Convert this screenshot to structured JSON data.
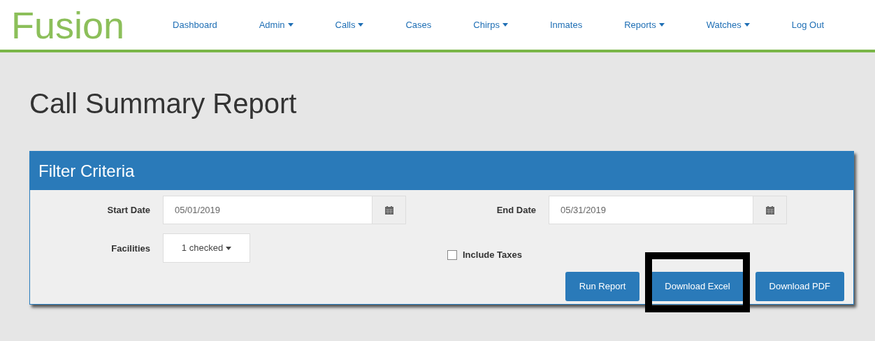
{
  "brand": "Fusion",
  "nav": [
    {
      "label": "Dashboard",
      "dropdown": false
    },
    {
      "label": "Admin",
      "dropdown": true
    },
    {
      "label": "Calls",
      "dropdown": true
    },
    {
      "label": "Cases",
      "dropdown": false
    },
    {
      "label": "Chirps",
      "dropdown": true
    },
    {
      "label": "Inmates",
      "dropdown": false
    },
    {
      "label": "Reports",
      "dropdown": true
    },
    {
      "label": "Watches",
      "dropdown": true
    },
    {
      "label": "Log Out",
      "dropdown": false
    }
  ],
  "page_title": "Call Summary Report",
  "panel": {
    "title": "Filter Criteria",
    "start_date": {
      "label": "Start Date",
      "value": "05/01/2019"
    },
    "end_date": {
      "label": "End Date",
      "value": "05/31/2019"
    },
    "facilities": {
      "label": "Facilities",
      "value": "1 checked"
    },
    "include_taxes": {
      "label": "Include Taxes",
      "checked": false
    },
    "buttons": [
      {
        "label": "Run Report",
        "highlighted": false
      },
      {
        "label": "Download Excel",
        "highlighted": true
      },
      {
        "label": "Download PDF",
        "highlighted": false
      }
    ]
  }
}
